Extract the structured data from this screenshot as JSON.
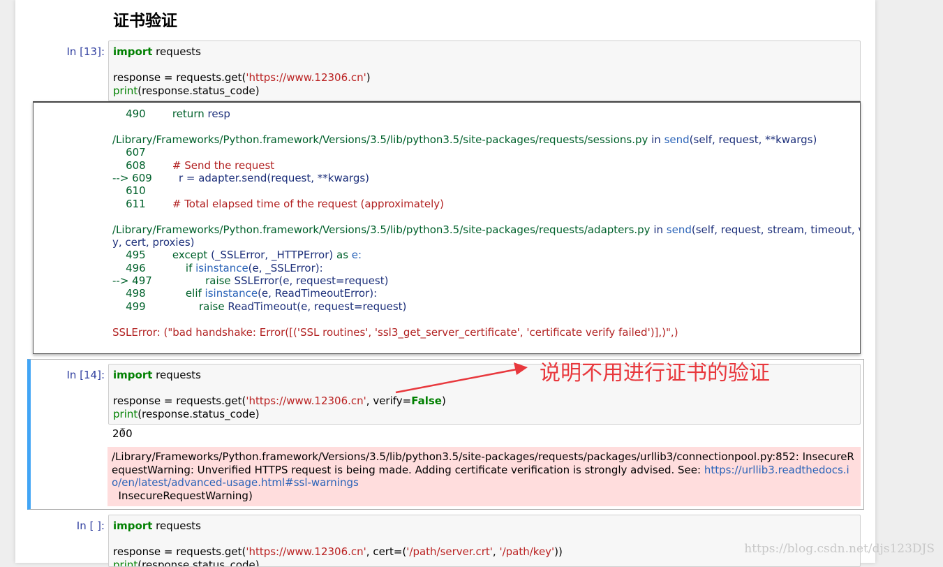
{
  "heading": "证书验证",
  "cell13": {
    "prompt": "In [13]:",
    "code": [
      [
        {
          "t": "import",
          "c": "kw"
        },
        {
          "t": " requests"
        }
      ],
      [],
      [
        {
          "t": "response = requests.get("
        },
        {
          "t": "'https://www.12306.cn'",
          "c": "str"
        },
        {
          "t": ")"
        }
      ],
      [
        {
          "t": "print",
          "c": "bi"
        },
        {
          "t": "(response.status_code)"
        }
      ]
    ]
  },
  "traceback": [
    [
      {
        "t": "    490        ",
        "c": "tb-green"
      },
      {
        "t": "return",
        "c": "tb-green"
      },
      {
        "t": " resp",
        "c": "tb-navy"
      }
    ],
    [],
    [
      {
        "t": "/Library/Frameworks/Python.framework/Versions/3.5/lib/python3.5/site-packages/requests/sessions.py",
        "c": "tb-path"
      },
      {
        "t": " in ",
        "c": "tb-navy"
      },
      {
        "t": "send",
        "c": "tb-blue"
      },
      {
        "t": "(self, request, **kwargs)",
        "c": "tb-navy"
      }
    ],
    [
      {
        "t": "    607",
        "c": "tb-green"
      }
    ],
    [
      {
        "t": "    608        ",
        "c": "tb-green"
      },
      {
        "t": "# Send the request",
        "c": "tb-red"
      }
    ],
    [
      {
        "t": "--> 609        ",
        "c": "tb-green"
      },
      {
        "t": "r = adapter.send(request, **kwargs)",
        "c": "tb-navy"
      }
    ],
    [
      {
        "t": "    610",
        "c": "tb-green"
      }
    ],
    [
      {
        "t": "    611        ",
        "c": "tb-green"
      },
      {
        "t": "# Total elapsed time of the request (approximately)",
        "c": "tb-red"
      }
    ],
    [],
    [
      {
        "t": "/Library/Frameworks/Python.framework/Versions/3.5/lib/python3.5/site-packages/requests/adapters.py",
        "c": "tb-path"
      },
      {
        "t": " in ",
        "c": "tb-navy"
      },
      {
        "t": "send",
        "c": "tb-blue"
      },
      {
        "t": "(self, request, stream, timeout, verif",
        "c": "tb-navy"
      }
    ],
    [
      {
        "t": "y, cert, proxies)",
        "c": "tb-navy"
      }
    ],
    [
      {
        "t": "    495        ",
        "c": "tb-green"
      },
      {
        "t": "except",
        "c": "tb-green"
      },
      {
        "t": " (_SSLError, _HTTPError) ",
        "c": "tb-navy"
      },
      {
        "t": "as",
        "c": "tb-green"
      },
      {
        "t": " e:",
        "c": "tb-blue"
      }
    ],
    [
      {
        "t": "    496            ",
        "c": "tb-green"
      },
      {
        "t": "if",
        "c": "tb-green"
      },
      {
        "t": " isinstance",
        "c": "tb-blue"
      },
      {
        "t": "(e, _SSLError):",
        "c": "tb-navy"
      }
    ],
    [
      {
        "t": "--> 497                ",
        "c": "tb-green"
      },
      {
        "t": "raise",
        "c": "tb-green"
      },
      {
        "t": " SSLError(e, request=request)",
        "c": "tb-navy"
      }
    ],
    [
      {
        "t": "    498            ",
        "c": "tb-green"
      },
      {
        "t": "elif",
        "c": "tb-green"
      },
      {
        "t": " isinstance",
        "c": "tb-blue"
      },
      {
        "t": "(e, ReadTimeoutError):",
        "c": "tb-navy"
      }
    ],
    [
      {
        "t": "    499                ",
        "c": "tb-green"
      },
      {
        "t": "raise",
        "c": "tb-green"
      },
      {
        "t": " ReadTimeout(e, request=request)",
        "c": "tb-navy"
      }
    ],
    [],
    [
      {
        "t": "SSLError",
        "c": "tb-red"
      },
      {
        "t": ": (\"bad handshake: Error([('SSL routines', 'ssl3_get_server_certificate', 'certificate verify failed')],)\",)",
        "c": "tb-red"
      }
    ]
  ],
  "cell14": {
    "prompt": "In [14]:",
    "code": [
      [
        {
          "t": "import",
          "c": "kw"
        },
        {
          "t": " requests"
        }
      ],
      [],
      [
        {
          "t": "response = requests.get("
        },
        {
          "t": "'https://www.12306.cn'",
          "c": "str"
        },
        {
          "t": ", verify="
        },
        {
          "t": "False",
          "c": "kw"
        },
        {
          "t": ")"
        }
      ],
      [
        {
          "t": "print",
          "c": "bi"
        },
        {
          "t": "(response.status_code)"
        }
      ]
    ],
    "output": "200",
    "stderr_text": "/Library/Frameworks/Python.framework/Versions/3.5/lib/python3.5/site-packages/requests/packages/urllib3/connectionpool.py:852: InsecureRequestWarning: Unverified HTTPS request is being made. Adding certificate verification is strongly advised. See: ",
    "stderr_link": "https://urllib3.readthedocs.io/en/latest/advanced-usage.html#ssl-warnings",
    "stderr_tail": "\n  InsecureRequestWarning)"
  },
  "cell_empty": {
    "prompt": "In [ ]:",
    "code": [
      [
        {
          "t": "import",
          "c": "kw"
        },
        {
          "t": " requests"
        }
      ],
      [],
      [
        {
          "t": "response = requests.get("
        },
        {
          "t": "'https://www.12306.cn'",
          "c": "str"
        },
        {
          "t": ", cert=("
        },
        {
          "t": "'/path/server.crt'",
          "c": "str"
        },
        {
          "t": ", "
        },
        {
          "t": "'/path/key'",
          "c": "str"
        },
        {
          "t": "))"
        }
      ],
      [
        {
          "t": "print",
          "c": "bi"
        },
        {
          "t": "(response.status_code)"
        }
      ]
    ]
  },
  "annotation": "说明不用进行证书的验证",
  "watermark": "https://blog.csdn.net/djs123DJS",
  "colors": {
    "annotation": "#e8383d",
    "selected_cell_border": "#42a5f5",
    "stderr_bg": "#ffdddd",
    "prompt": "#303f9f"
  }
}
